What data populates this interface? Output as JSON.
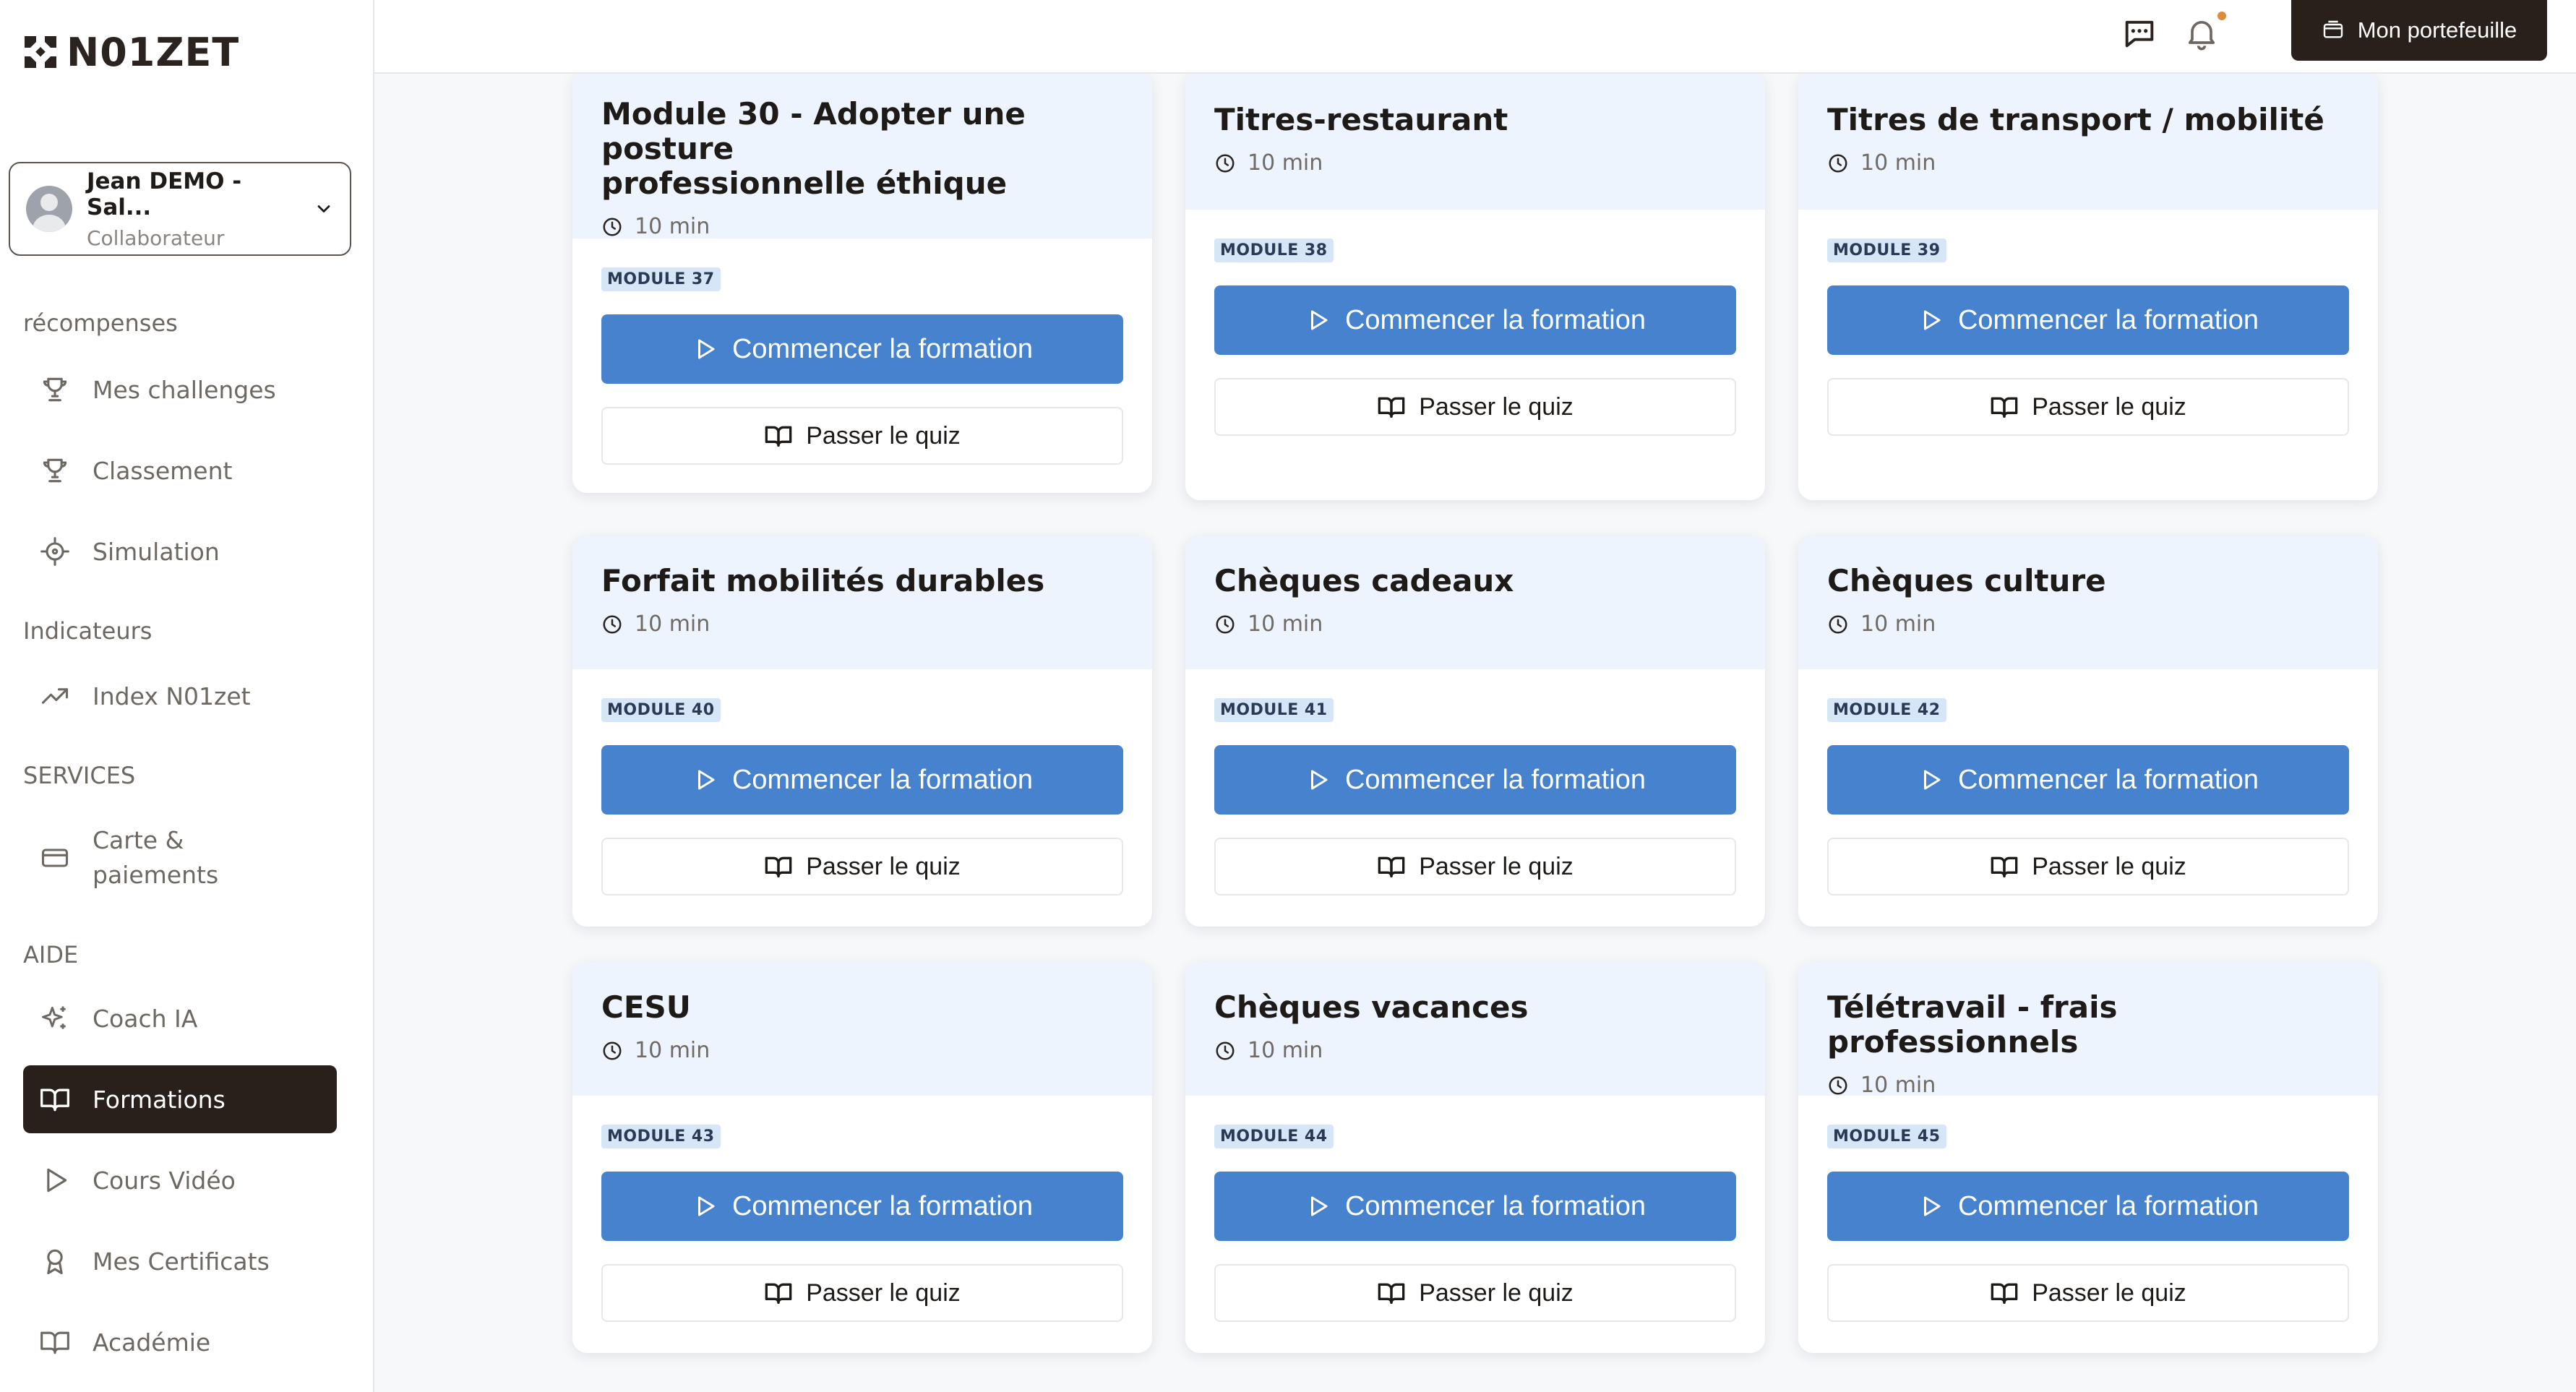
{
  "brand": {
    "name": "N01ZET"
  },
  "user": {
    "name": "Jean DEMO - Sal...",
    "role": "Collaborateur"
  },
  "nav": {
    "sections": {
      "rewards": "récompenses",
      "indicators": "Indicateurs",
      "services": "SERVICES",
      "help": "AIDE"
    },
    "items": {
      "challenges": "Mes challenges",
      "ranking": "Classement",
      "simulation": "Simulation",
      "index": "Index N01zet",
      "card_line1": "Carte &",
      "card_line2": "paiements",
      "coach": "Coach IA",
      "formations": "Formations",
      "videos": "Cours Vidéo",
      "certificates": "Mes Certificats",
      "academy": "Académie"
    }
  },
  "topbar": {
    "wallet_label": "Mon portefeuille"
  },
  "buttons": {
    "start": "Commencer la formation",
    "quiz": "Passer le quiz"
  },
  "modules": [
    {
      "title_line1": "Module 30 - Adopter une posture",
      "title_line2": "professionnelle éthique",
      "duration": "10 min",
      "badge": "MODULE 37"
    },
    {
      "title_line1": "Titres-restaurant",
      "title_line2": "",
      "duration": "10 min",
      "badge": "MODULE 38"
    },
    {
      "title_line1": "Titres de transport / mobilité",
      "title_line2": "",
      "duration": "10 min",
      "badge": "MODULE 39"
    },
    {
      "title_line1": "Forfait mobilités durables",
      "title_line2": "",
      "duration": "10 min",
      "badge": "MODULE 40"
    },
    {
      "title_line1": "Chèques cadeaux",
      "title_line2": "",
      "duration": "10 min",
      "badge": "MODULE 41"
    },
    {
      "title_line1": "Chèques culture",
      "title_line2": "",
      "duration": "10 min",
      "badge": "MODULE 42"
    },
    {
      "title_line1": "CESU",
      "title_line2": "",
      "duration": "10 min",
      "badge": "MODULE 43"
    },
    {
      "title_line1": "Chèques vacances",
      "title_line2": "",
      "duration": "10 min",
      "badge": "MODULE 44"
    },
    {
      "title_line1": "Télétravail - frais professionnels",
      "title_line2": "",
      "duration": "10 min",
      "badge": "MODULE 45"
    }
  ]
}
